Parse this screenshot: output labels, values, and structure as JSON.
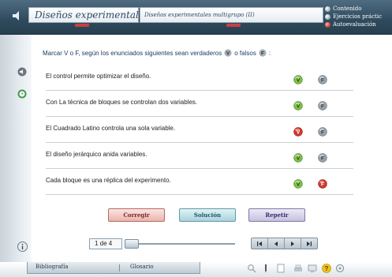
{
  "header": {
    "title": "Diseños experimentales",
    "subtitle": "Diseños experimentales multigrupo (II)"
  },
  "nav": {
    "items": [
      {
        "label": "Contenido",
        "active": false
      },
      {
        "label": "Ejercicios práctic",
        "active": false
      },
      {
        "label": "Autoevaluación",
        "active": true
      }
    ]
  },
  "quiz": {
    "instruction_prefix": "Marcar V o F, según los enunciados siguientes sean verdaderos",
    "instruction_mid": "o falsos",
    "instruction_suffix": ":",
    "v_letter": "V",
    "f_letter": "F",
    "statements": [
      {
        "text": "El control permite optimizar el diseño.",
        "v_state": "default",
        "f_state": "default"
      },
      {
        "text": "Con La técnica de  bloques se controlan dos variables.",
        "v_state": "default",
        "f_state": "default"
      },
      {
        "text": "El Cuadrado Latino controla una sola variable.",
        "v_state": "selected",
        "f_state": "default"
      },
      {
        "text": "El diseño jerárquico anida variables.",
        "v_state": "default",
        "f_state": "default"
      },
      {
        "text": "Cada bloque es una réplica del experimento.",
        "v_state": "default",
        "f_state": "selected"
      }
    ]
  },
  "actions": {
    "corregir": "Corregir",
    "solucion": "Solución",
    "repetir": "Repetir"
  },
  "pager": {
    "page_text": "1 de 4",
    "current_page": 1,
    "total_pages": 4,
    "slider_fraction": 0.0
  },
  "bottom_tabs": {
    "bibliografia": "Bibliografía",
    "glosario": "Glosario"
  },
  "colors": {
    "header_dark": "#2f4a5e",
    "v_green": "#7fbf4a",
    "f_gray": "#9aa3aa",
    "selected_red": "#d23a2e",
    "instruction_text": "#1e3a64"
  }
}
